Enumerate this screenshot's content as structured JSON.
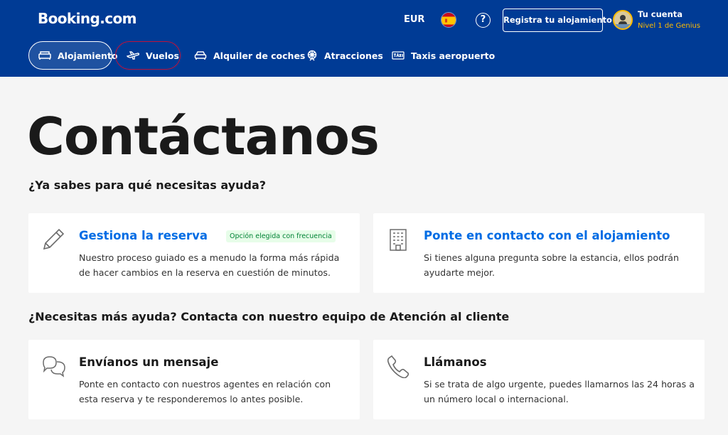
{
  "header": {
    "logo": "Booking.com",
    "currency": "EUR",
    "language_flag": "es-flag-icon",
    "help_symbol": "?",
    "register_label": "Registra tu alojamiento",
    "account_name": "Tu cuenta",
    "account_level": "Nivel 1 de Genius",
    "colors": {
      "background": "#003b95",
      "accent": "#febb02"
    }
  },
  "nav": {
    "items": [
      {
        "label": "Alojamiento",
        "icon": "bed-icon",
        "active": true
      },
      {
        "label": "Vuelos",
        "icon": "plane-icon",
        "active": false
      },
      {
        "label": "Alquiler de coches",
        "icon": "car-icon",
        "active": false
      },
      {
        "label": "Atracciones",
        "icon": "attractions-icon",
        "active": false
      },
      {
        "label": "Taxis aeropuerto",
        "icon": "taxi-icon",
        "active": false
      }
    ]
  },
  "main": {
    "title": "Contáctanos",
    "section1_title": "¿Ya sabes para qué necesitas ayuda?",
    "section2_title": "¿Necesitas más ayuda? Contacta con nuestro equipo de Atención al cliente",
    "cards": [
      {
        "title": "Gestiona la reserva",
        "badge": "Opción elegida con frecuencia",
        "description": "Nuestro proceso guiado es a menudo la forma más rápida de hacer cambios en la reserva en cuestión de minutos.",
        "icon": "pencil-icon"
      },
      {
        "title": "Ponte en contacto con el alojamiento",
        "description": "Si tienes alguna pregunta sobre la estancia, ellos podrán ayudarte mejor.",
        "icon": "building-icon"
      },
      {
        "title": "Envíanos un mensaje",
        "description": "Ponte en contacto con nuestros agentes en relación con esta reserva y te responderemos lo antes posible.",
        "icon": "chat-bubbles-icon"
      },
      {
        "title": "Llámanos",
        "description": "Si se trata de algo urgente, puedes llamarnos las 24 horas a un número local o internacional.",
        "icon": "phone-icon"
      }
    ]
  }
}
